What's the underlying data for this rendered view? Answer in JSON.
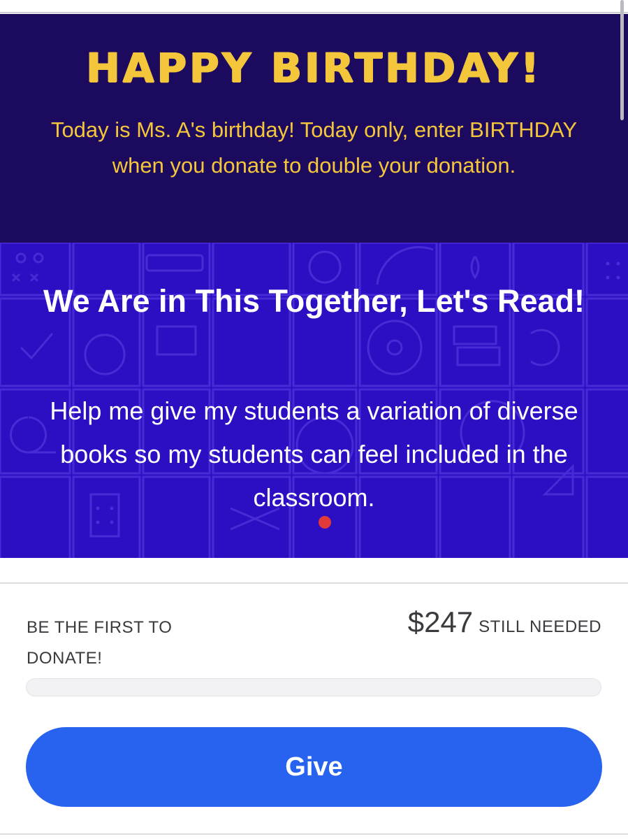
{
  "banner": {
    "title": "HAPPY BIRTHDAY!",
    "message": "Today is Ms. A's birthday! Today only, enter BIRTHDAY when you donate to double your donation."
  },
  "project": {
    "title": "We Are in This Together, Let's Read!",
    "description": "Help me give my students a variation of diverse books so my students can feel included in the classroom."
  },
  "donation": {
    "first_label": "BE THE FIRST TO DONATE!",
    "amount_needed": "$247",
    "needed_label": "STILL NEEDED",
    "progress_percent": 0
  },
  "give_button": {
    "label": "Give"
  },
  "colors": {
    "banner_bg": "#1c0a5e",
    "banner_text": "#f4c63b",
    "hero_bg": "#2c0fc3",
    "button_bg": "#2763ef"
  },
  "icons": [
    "school-supplies-pattern"
  ]
}
